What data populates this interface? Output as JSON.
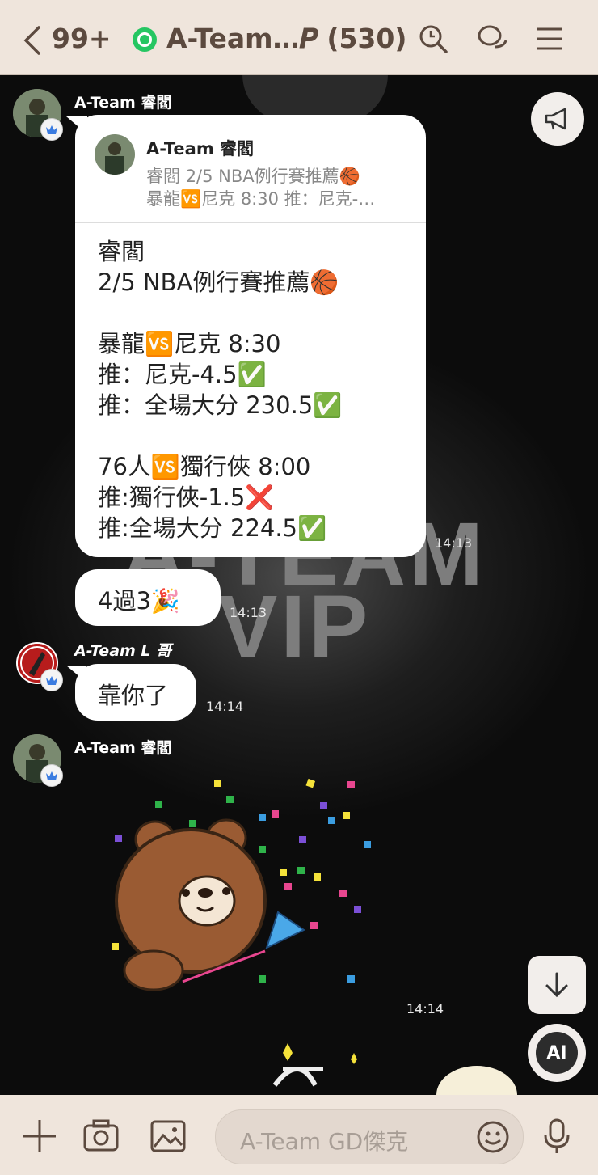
{
  "header": {
    "back_count": "99+",
    "title": "A-Team…𝑷 (530)"
  },
  "messages": {
    "m1": {
      "sender": "A-Team 睿閻",
      "quote_sender": "A-Team 睿閻",
      "quote_line1": "睿閻 2/5 NBA例行賽推薦🏀",
      "quote_line2": "暴龍🆚尼克 8:30 推：尼克-…",
      "text": "睿閻\n2/5 NBA例行賽推薦🏀\n\n暴龍🆚尼克 8:30\n推：尼克-4.5✅\n推：全場大分 230.5✅\n\n76人🆚獨行俠 8:00\n推:獨行俠-1.5❌\n推:全場大分 224.5✅",
      "time": "14:13"
    },
    "m2": {
      "text": "4過3🎉",
      "time": "14:13"
    },
    "m3": {
      "sender": "A-Team L 哥",
      "text": "靠你了",
      "time": "14:14"
    },
    "m4": {
      "sender": "A-Team 睿閻",
      "time": "14:14",
      "sticker": "brown-bear-party-popper"
    }
  },
  "watermark": {
    "line1": "A-TEAM",
    "line2": "VIP"
  },
  "buttons": {
    "ai_label": "AI"
  },
  "footer": {
    "input_placeholder": "A-Team GD傑克"
  },
  "colors": {
    "header_bg": "#efe5dc",
    "chat_bg": "#1a1a1a",
    "bubble": "#ffffff",
    "badge_green": "#25c662"
  }
}
